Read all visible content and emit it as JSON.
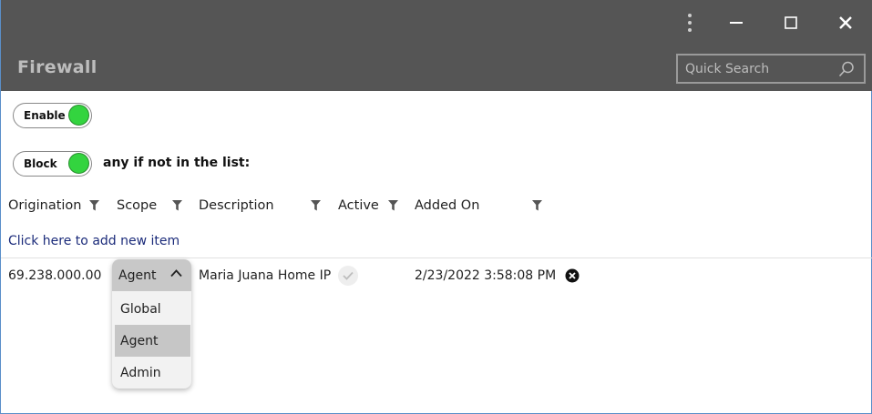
{
  "app": {
    "title": "Firewall"
  },
  "window_controls": {
    "menu_icon": "kebab-icon",
    "minimize_icon": "minimize-icon",
    "maximize_icon": "maximize-icon",
    "close_icon": "close-icon"
  },
  "search": {
    "placeholder": "Quick Search",
    "value": ""
  },
  "toggles": {
    "enable": {
      "label": "Enable",
      "on": true
    },
    "block": {
      "label": "Block",
      "on": true,
      "suffix": "any if not in the list:"
    }
  },
  "table": {
    "columns": [
      "Origination",
      "Scope",
      "Description",
      "Active",
      "Added On"
    ],
    "add_link": "Click here to add new item",
    "rows": [
      {
        "origination": "69.238.000.00",
        "scope": "Agent",
        "description": "Maria Juana Home IP",
        "active": true,
        "added_on": "2/23/2022 3:58:08 PM"
      }
    ]
  },
  "scope_dropdown": {
    "selected": "Agent",
    "options": [
      "Global",
      "Agent",
      "Admin"
    ]
  },
  "colors": {
    "titlebar": "#555555",
    "toggle_on": "#33d43f",
    "link": "#1b2b7a"
  }
}
